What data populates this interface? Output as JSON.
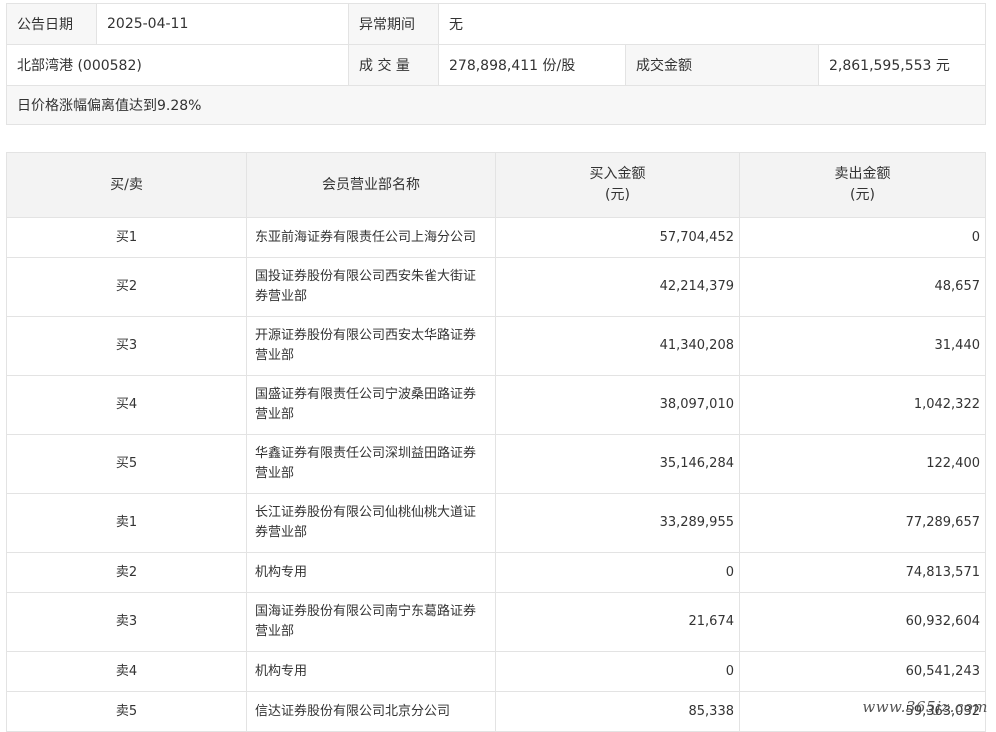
{
  "info": {
    "date_label": "公告日期",
    "date_value": "2025-04-11",
    "period_label": "异常期间",
    "period_value": "无",
    "stock": "北部湾港 (000582)",
    "volume_label": "成 交 量",
    "volume_value": "278,898,411 份/股",
    "amount_label": "成交金额",
    "amount_value": "2,861,595,553 元",
    "reason": "日价格涨幅偏离值达到9.28%"
  },
  "table": {
    "headers": {
      "side": "买/卖",
      "name": "会员营业部名称",
      "buy_line1": "买入金额",
      "buy_line2": "(元)",
      "sell_line1": "卖出金额",
      "sell_line2": "(元)"
    },
    "rows": [
      {
        "side": "买1",
        "name": "东亚前海证券有限责任公司上海分公司",
        "buy": "57,704,452",
        "sell": "0"
      },
      {
        "side": "买2",
        "name": "国投证券股份有限公司西安朱雀大街证券营业部",
        "buy": "42,214,379",
        "sell": "48,657"
      },
      {
        "side": "买3",
        "name": "开源证券股份有限公司西安太华路证券营业部",
        "buy": "41,340,208",
        "sell": "31,440"
      },
      {
        "side": "买4",
        "name": "国盛证券有限责任公司宁波桑田路证券营业部",
        "buy": "38,097,010",
        "sell": "1,042,322"
      },
      {
        "side": "买5",
        "name": "华鑫证券有限责任公司深圳益田路证券营业部",
        "buy": "35,146,284",
        "sell": "122,400"
      },
      {
        "side": "卖1",
        "name": "长江证券股份有限公司仙桃仙桃大道证券营业部",
        "buy": "33,289,955",
        "sell": "77,289,657"
      },
      {
        "side": "卖2",
        "name": "机构专用",
        "buy": "0",
        "sell": "74,813,571"
      },
      {
        "side": "卖3",
        "name": "国海证券股份有限公司南宁东葛路证券营业部",
        "buy": "21,674",
        "sell": "60,932,604"
      },
      {
        "side": "卖4",
        "name": "机构专用",
        "buy": "0",
        "sell": "60,541,243"
      },
      {
        "side": "卖5",
        "name": "信达证券股份有限公司北京分公司",
        "buy": "85,338",
        "sell": "59,363,032"
      }
    ]
  },
  "watermark": "www.365jz.com"
}
